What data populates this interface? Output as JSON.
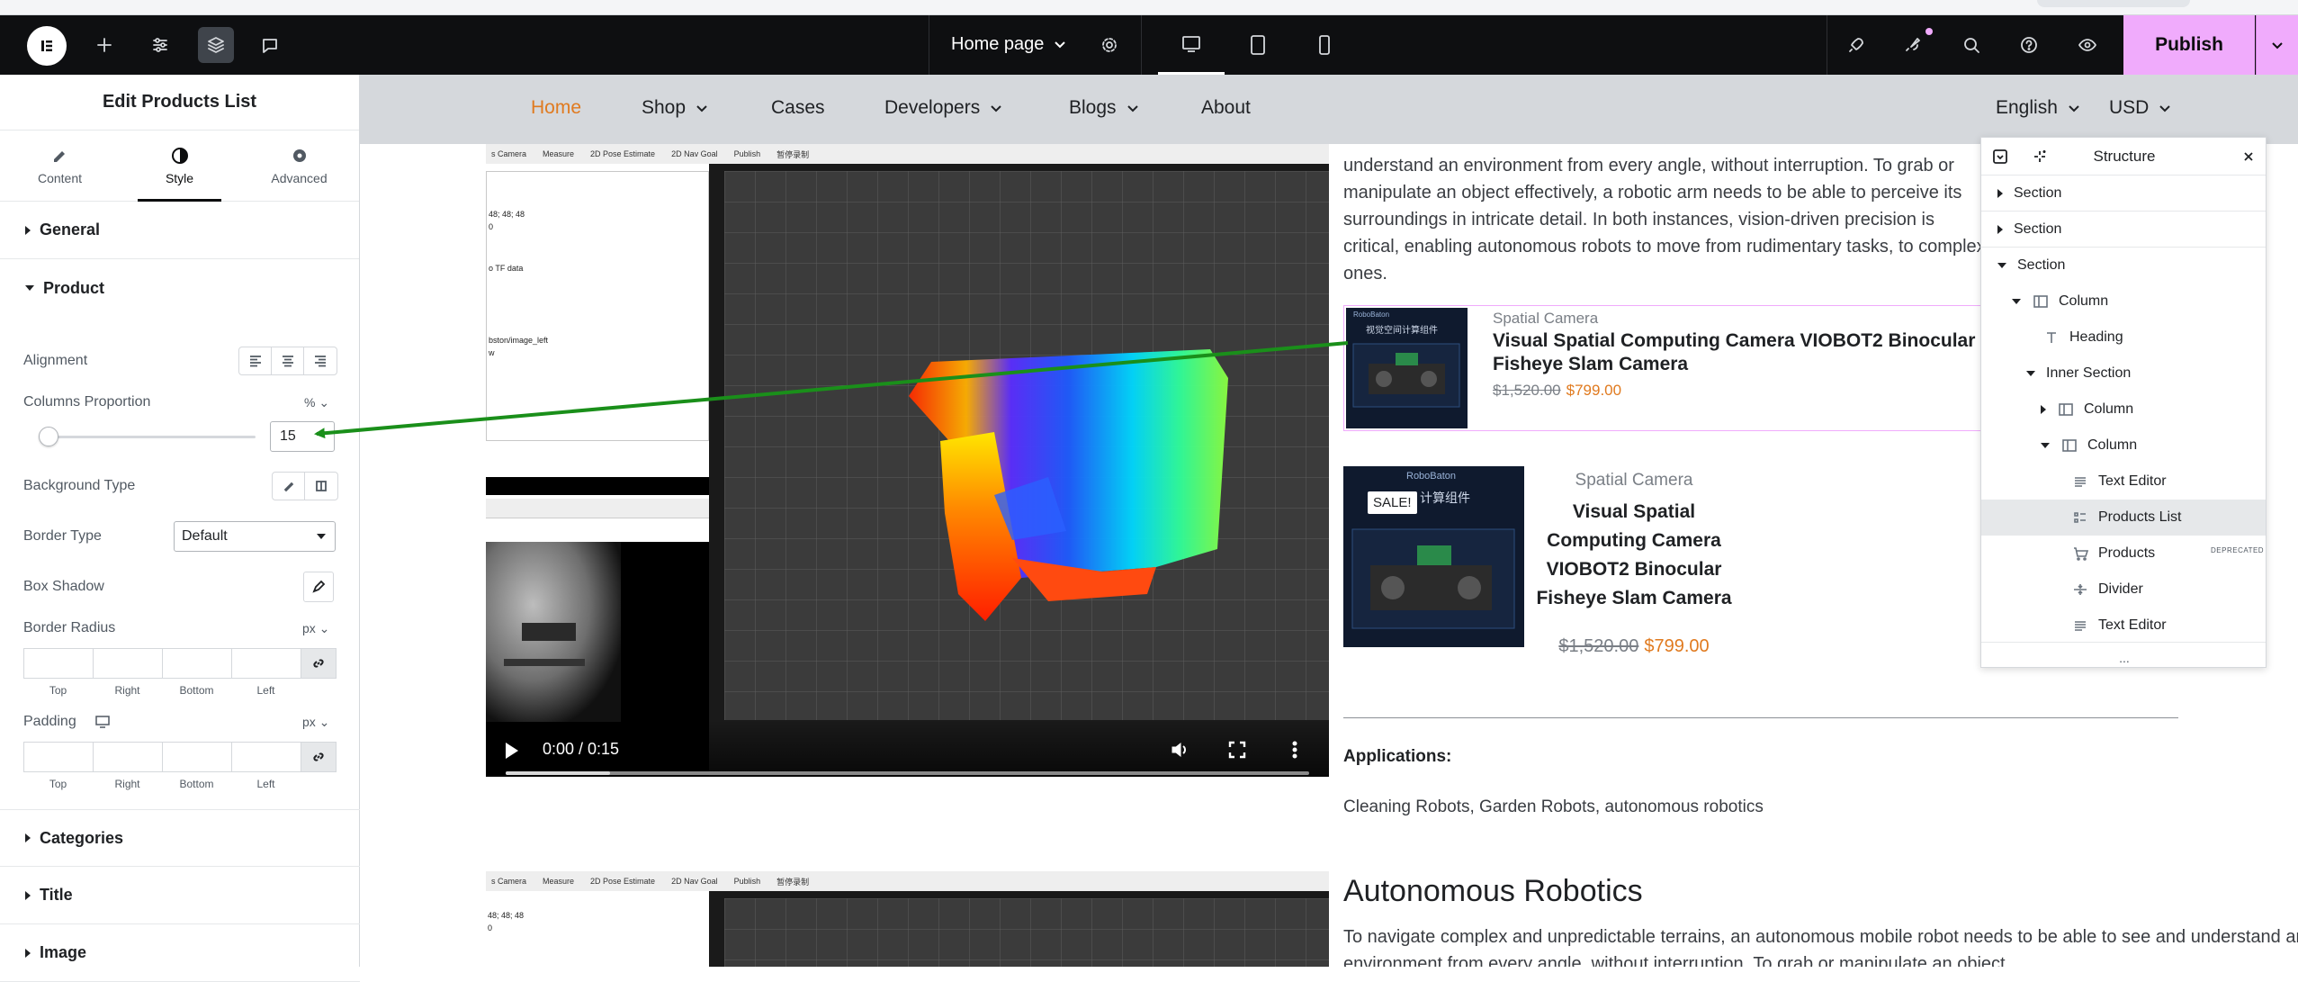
{
  "topbar": {
    "page_name": "Home page",
    "publish_label": "Publish"
  },
  "panel": {
    "title": "Edit Products List",
    "tabs": [
      {
        "label": "Content",
        "icon": "pencil-icon"
      },
      {
        "label": "Style",
        "icon": "half-circle-icon"
      },
      {
        "label": "Advanced",
        "icon": "gear-icon"
      }
    ],
    "sections": {
      "general": "General",
      "product": "Product",
      "categories": "Categories",
      "title": "Title",
      "image": "Image"
    },
    "alignment_label": "Alignment",
    "columns_proportion_label": "Columns Proportion",
    "columns_proportion_unit": "%",
    "columns_proportion_value": "15",
    "columns_proportion_level_percent": 15,
    "background_type_label": "Background Type",
    "border_type_label": "Border Type",
    "border_type_value": "Default",
    "box_shadow_label": "Box Shadow",
    "border_radius_label": "Border Radius",
    "border_radius_unit": "px",
    "padding_label": "Padding",
    "padding_unit": "px",
    "dim_labels": [
      "Top",
      "Right",
      "Bottom",
      "Left"
    ]
  },
  "site_nav": {
    "items": [
      "Home",
      "Shop",
      "Cases",
      "Developers",
      "Blogs",
      "About"
    ],
    "active": "Home",
    "language": "English",
    "currency": "USD"
  },
  "video": {
    "time": "0:00 / 0:15",
    "progress_fraction": 0.13,
    "toolbar_items": [
      "s Camera",
      "Measure",
      "2D Pose Estimate",
      "2D Nav Goal",
      "Publish",
      "暂停录制"
    ],
    "tree_lines": [
      "48; 48; 48",
      "0",
      "o TF data",
      "bston/image_left",
      "w"
    ]
  },
  "content": {
    "intro_text": "understand an environment from every angle, without interruption. To grab or manipulate an object effectively, a robotic arm needs to be able to perceive its surroundings in intricate detail. In both instances, vision-driven precision is critical, enabling autonomous robots to move from rudimentary tasks, to complex ones.",
    "product1": {
      "category": "Spatial Camera",
      "title": "Visual Spatial Computing Camera VIOBOT2 Binocular Fisheye Slam Camera",
      "old_price": "$1,520.00",
      "new_price": "$799.00",
      "thumb_brand": "RoboBaton",
      "thumb_caption": "视觉空间计算组件"
    },
    "product2": {
      "sale_badge": "SALE!",
      "category": "Spatial Camera",
      "title": "Visual Spatial Computing Camera VIOBOT2 Binocular Fisheye Slam Camera",
      "old_price": "$1,520.00",
      "new_price": "$799.00",
      "thumb_brand": "RoboBaton",
      "thumb_caption": "计算组件"
    },
    "applications_label": "Applications:",
    "applications_value": "Cleaning Robots, Garden Robots, autonomous robotics",
    "heading2": "Autonomous Robotics",
    "text2": "To navigate complex and unpredictable terrains, an autonomous mobile robot needs to be able to see and understand an environment from every angle, without interruption. To grab or manipulate an object"
  },
  "structure": {
    "title": "Structure",
    "items": [
      {
        "label": "Section",
        "depth": 0,
        "caret": "closed",
        "icon": ""
      },
      {
        "label": "Section",
        "depth": 0,
        "caret": "closed",
        "icon": ""
      },
      {
        "label": "Section",
        "depth": 0,
        "caret": "open",
        "icon": ""
      },
      {
        "label": "Column",
        "depth": 1,
        "caret": "open",
        "icon": "column-icon"
      },
      {
        "label": "Heading",
        "depth": 2,
        "caret": "",
        "icon": "heading-icon"
      },
      {
        "label": "Inner Section",
        "depth": 2,
        "caret": "open",
        "icon": ""
      },
      {
        "label": "Column",
        "depth": 3,
        "caret": "closed",
        "icon": "column-icon"
      },
      {
        "label": "Column",
        "depth": 3,
        "caret": "open",
        "icon": "column-icon"
      },
      {
        "label": "Text Editor",
        "depth": 4,
        "caret": "",
        "icon": "text-editor-icon"
      },
      {
        "label": "Products List",
        "depth": 4,
        "caret": "",
        "icon": "products-list-icon"
      },
      {
        "label": "Products",
        "depth": 4,
        "caret": "",
        "icon": "cart-icon"
      },
      {
        "label": "Divider",
        "depth": 4,
        "caret": "",
        "icon": "divider-icon"
      },
      {
        "label": "Text Editor",
        "depth": 4,
        "caret": "",
        "icon": "text-editor-icon"
      }
    ],
    "deprecated_label": "DEPRECATED",
    "more": "..."
  },
  "colors": {
    "accent_publish": "#f0abfc",
    "nav_active": "#e07a1f",
    "price_sale": "#e07a1f",
    "annotation_arrow": "#1a8f1a"
  }
}
